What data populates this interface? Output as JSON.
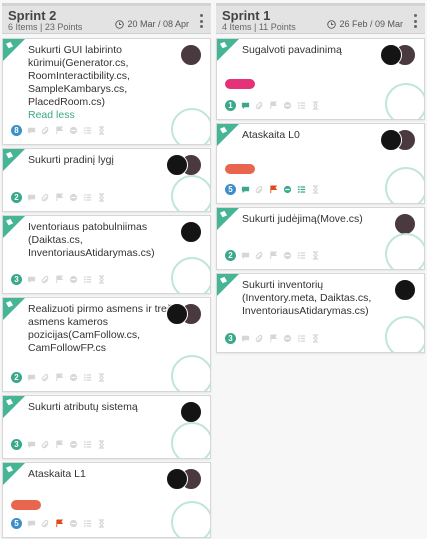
{
  "sprints": [
    {
      "title": "Sprint 2",
      "meta": "6 Items | 23 Points",
      "dates": "20 Mar / 08 Apr",
      "cards": [
        {
          "title": "Sukurti GUI labirinto kūrimui(Generator.cs, RoomInteractibility.cs, SampleKambarys.cs, PlacedRoom.cs)",
          "link": "Read less",
          "count": "8"
        },
        {
          "title": "Sukurti pradinį lygį",
          "count": "2"
        },
        {
          "title": "Iventoriaus patobulniimas (Daiktas.cs, InventoriausAtidarymas.cs)",
          "count": "3"
        },
        {
          "title": "Realizuoti pirmo asmens ir trečio asmens kameros pozicijas(CamFollow.cs, CamFollowFP.cs",
          "count": "2"
        },
        {
          "title": "Sukurti atributų sistemą",
          "count": "3"
        },
        {
          "title": "Ataskaita L1",
          "count": "5"
        }
      ]
    },
    {
      "title": "Sprint 1",
      "meta": "4 Items | 11 Points",
      "dates": "26 Feb / 09 Mar",
      "cards": [
        {
          "title": "Sugalvoti pavadinimą",
          "count": "1"
        },
        {
          "title": "Ataskaita L0",
          "count": "5"
        },
        {
          "title": "Sukurti judėjimą(Move.cs)",
          "count": "2"
        },
        {
          "title": "Sukurti inventorių (Inventory.meta, Daiktas.cs, InventoriausAtidarymas.cs)",
          "count": "3"
        }
      ]
    }
  ],
  "colors": {
    "accent": "#45b595",
    "badge_green": "#3aa88a",
    "badge_blue": "#3c8ec9",
    "tag_pink": "#e5317a",
    "tag_orange": "#e8664d",
    "flag_red": "#e04a1f",
    "done_circle": "#bfe6d8"
  }
}
